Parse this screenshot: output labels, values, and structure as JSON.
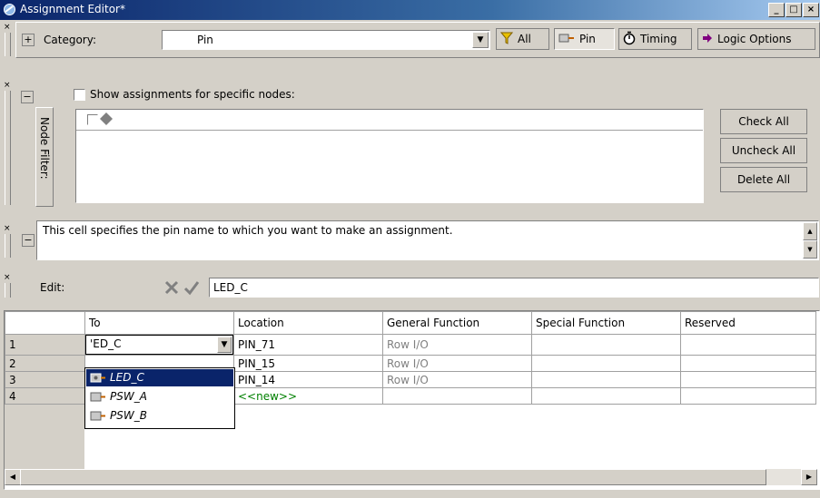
{
  "window": {
    "title": "Assignment Editor*"
  },
  "category_bar": {
    "label": "Category:",
    "value": "Pin",
    "buttons": [
      {
        "label": "All",
        "icon": "funnel-icon"
      },
      {
        "label": "Pin",
        "icon": "pin-icon",
        "pressed": true
      },
      {
        "label": "Timing",
        "icon": "stopwatch-icon"
      },
      {
        "label": "Logic Options",
        "icon": "arrow-icon"
      }
    ]
  },
  "node_filter": {
    "side_label": "Node Filter:",
    "checkbox_label": "Show assignments for specific nodes:",
    "buttons": {
      "check_all": "Check All",
      "uncheck_all": "Uncheck All",
      "delete_all": "Delete All"
    }
  },
  "info": {
    "text": "This cell specifies the pin name to which you want to make an assignment."
  },
  "edit_bar": {
    "label": "Edit:",
    "value": "LED_C"
  },
  "table": {
    "columns": [
      "To",
      "Location",
      "General Function",
      "Special Function",
      "Reserved"
    ],
    "rows": [
      {
        "num": "1",
        "to": "'ED_C",
        "location": "PIN_71",
        "general": "Row I/O",
        "special": "",
        "reserved": ""
      },
      {
        "num": "2",
        "to": "",
        "location": "PIN_15",
        "general": "Row I/O",
        "special": "",
        "reserved": ""
      },
      {
        "num": "3",
        "to": "",
        "location": "PIN_14",
        "general": "Row I/O",
        "special": "",
        "reserved": ""
      },
      {
        "num": "4",
        "to": "",
        "location": "<<new>>",
        "general": "",
        "special": "",
        "reserved": ""
      }
    ],
    "dropdown_options": [
      "LED_C",
      "PSW_A",
      "PSW_B"
    ],
    "dropdown_selected": "LED_C"
  },
  "colors": {
    "title_start": "#0a246a",
    "title_end": "#a6caf0",
    "selection": "#0a246a",
    "new_row": "#008000"
  }
}
